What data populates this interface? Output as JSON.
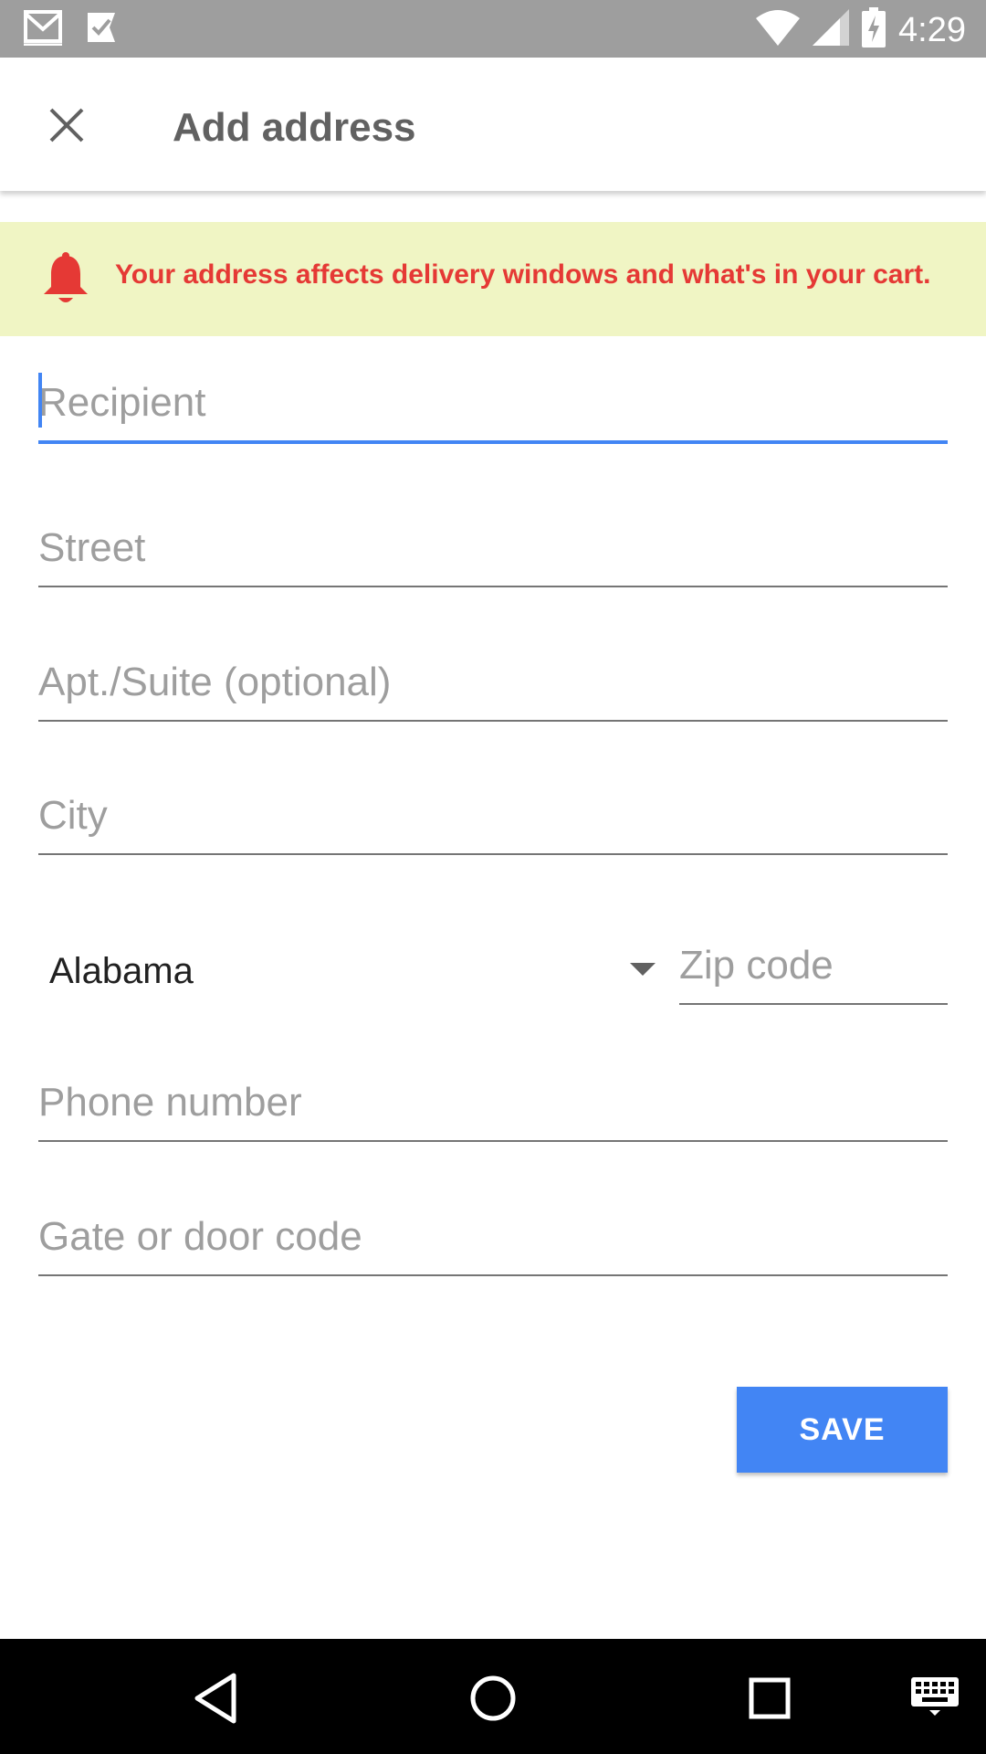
{
  "status_bar": {
    "time": "4:29",
    "icons": [
      "gmail-icon",
      "tasks-check-icon",
      "wifi-icon",
      "cell-signal-icon",
      "battery-charging-icon"
    ]
  },
  "app_bar": {
    "title": "Add address",
    "close_icon": "close-icon"
  },
  "alert": {
    "icon": "bell-icon",
    "message": "Your address affects delivery windows and what's in your cart.",
    "background": "#f0f5c4",
    "text_color": "#e53935"
  },
  "form": {
    "recipient": {
      "placeholder": "Recipient",
      "value": ""
    },
    "street": {
      "placeholder": "Street",
      "value": ""
    },
    "apt_suite": {
      "placeholder": "Apt./Suite (optional)",
      "value": ""
    },
    "city": {
      "placeholder": "City",
      "value": ""
    },
    "state": {
      "selected": "Alabama"
    },
    "zip": {
      "placeholder": "Zip code",
      "value": ""
    },
    "phone": {
      "placeholder": "Phone number",
      "value": ""
    },
    "gate_code": {
      "placeholder": "Gate or door code",
      "value": ""
    }
  },
  "actions": {
    "save_label": "SAVE",
    "accent": "#4285f4"
  },
  "nav_bar": {
    "icons": [
      "back-icon",
      "home-icon",
      "recents-icon",
      "keyboard-icon"
    ]
  }
}
